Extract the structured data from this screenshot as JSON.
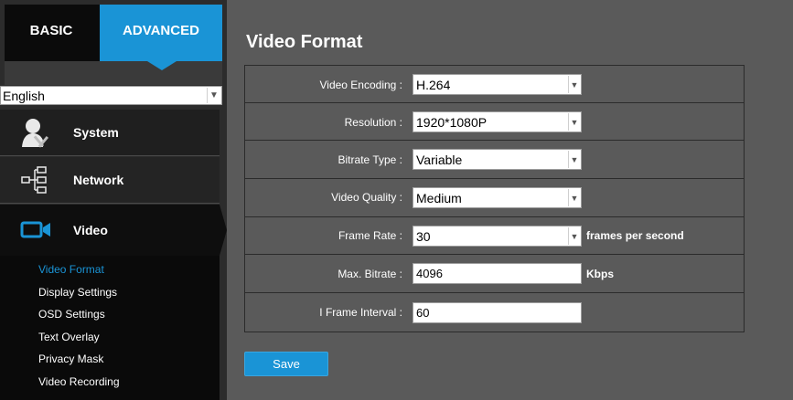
{
  "tabs": {
    "basic": "BASIC",
    "advanced": "ADVANCED"
  },
  "language": {
    "selected": "English"
  },
  "nav": {
    "system": "System",
    "network": "Network",
    "video": "Video"
  },
  "submenu": [
    {
      "label": "Video Format",
      "active": true
    },
    {
      "label": "Display Settings"
    },
    {
      "label": "OSD Settings"
    },
    {
      "label": "Text Overlay"
    },
    {
      "label": "Privacy Mask"
    },
    {
      "label": "Video Recording"
    }
  ],
  "page": {
    "title": "Video Format"
  },
  "form": {
    "video_encoding": {
      "label": "Video Encoding :",
      "value": "H.264"
    },
    "resolution": {
      "label": "Resolution :",
      "value": "1920*1080P"
    },
    "bitrate_type": {
      "label": "Bitrate Type :",
      "value": "Variable"
    },
    "video_quality": {
      "label": "Video Quality :",
      "value": "Medium"
    },
    "frame_rate": {
      "label": "Frame Rate :",
      "value": "30",
      "unit": "frames per second"
    },
    "max_bitrate": {
      "label": "Max. Bitrate :",
      "value": "4096",
      "unit": "Kbps"
    },
    "i_frame_interval": {
      "label": "I Frame Interval :",
      "value": "60"
    }
  },
  "actions": {
    "save": "Save"
  },
  "colors": {
    "accent": "#1a94d6",
    "background": "#5a5a5a",
    "sidebar": "#2c2c2c"
  }
}
